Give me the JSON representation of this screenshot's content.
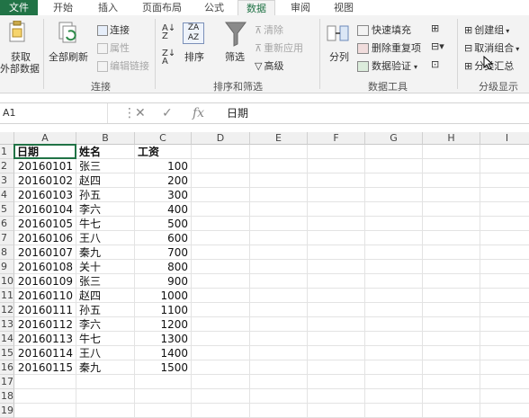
{
  "tabs": [
    {
      "label": "文件"
    },
    {
      "label": "开始"
    },
    {
      "label": "插入"
    },
    {
      "label": "页面布局"
    },
    {
      "label": "公式"
    },
    {
      "label": "数据"
    },
    {
      "label": "审阅"
    },
    {
      "label": "视图"
    }
  ],
  "ribbon": {
    "get_data": {
      "line1": "获取",
      "line2": "外部数据"
    },
    "refresh_all": "全部刷新",
    "connections": "连接",
    "properties": "属性",
    "edit_links": "编辑链接",
    "group_connections": "连接",
    "sort": "排序",
    "filter": "筛选",
    "clear": "清除",
    "reapply": "重新应用",
    "advanced": "高级",
    "group_sort_filter": "排序和筛选",
    "text_to_columns": "分列",
    "flash_fill": "快速填充",
    "remove_duplicates": "删除重复项",
    "data_validation": "数据验证",
    "group_data_tools": "数据工具",
    "group": "创建组",
    "ungroup": "取消组合",
    "subtotal": "分类汇总",
    "group_outline": "分级显示"
  },
  "formula_bar": {
    "name_box": "A1",
    "fx": "fx",
    "content": "日期"
  },
  "sheet": {
    "columns": [
      "A",
      "B",
      "C",
      "D",
      "E",
      "F",
      "G",
      "H",
      "I"
    ],
    "row_numbers": [
      "1",
      "2",
      "3",
      "4",
      "5",
      "6",
      "7",
      "8",
      "9",
      "10",
      "11",
      "12",
      "13",
      "14",
      "15",
      "16",
      "17",
      "18",
      "19"
    ],
    "header": [
      "日期",
      "姓名",
      "工资"
    ],
    "rows": [
      [
        "20160101",
        "张三",
        "100"
      ],
      [
        "20160102",
        "赵四",
        "200"
      ],
      [
        "20160103",
        "孙五",
        "300"
      ],
      [
        "20160104",
        "李六",
        "400"
      ],
      [
        "20160105",
        "牛七",
        "500"
      ],
      [
        "20160106",
        "王八",
        "600"
      ],
      [
        "20160107",
        "秦九",
        "700"
      ],
      [
        "20160108",
        "关十",
        "800"
      ],
      [
        "20160109",
        "张三",
        "900"
      ],
      [
        "20160110",
        "赵四",
        "1000"
      ],
      [
        "20160111",
        "孙五",
        "1100"
      ],
      [
        "20160112",
        "李六",
        "1200"
      ],
      [
        "20160113",
        "牛七",
        "1300"
      ],
      [
        "20160114",
        "王八",
        "1400"
      ],
      [
        "20160115",
        "秦九",
        "1500"
      ]
    ]
  }
}
